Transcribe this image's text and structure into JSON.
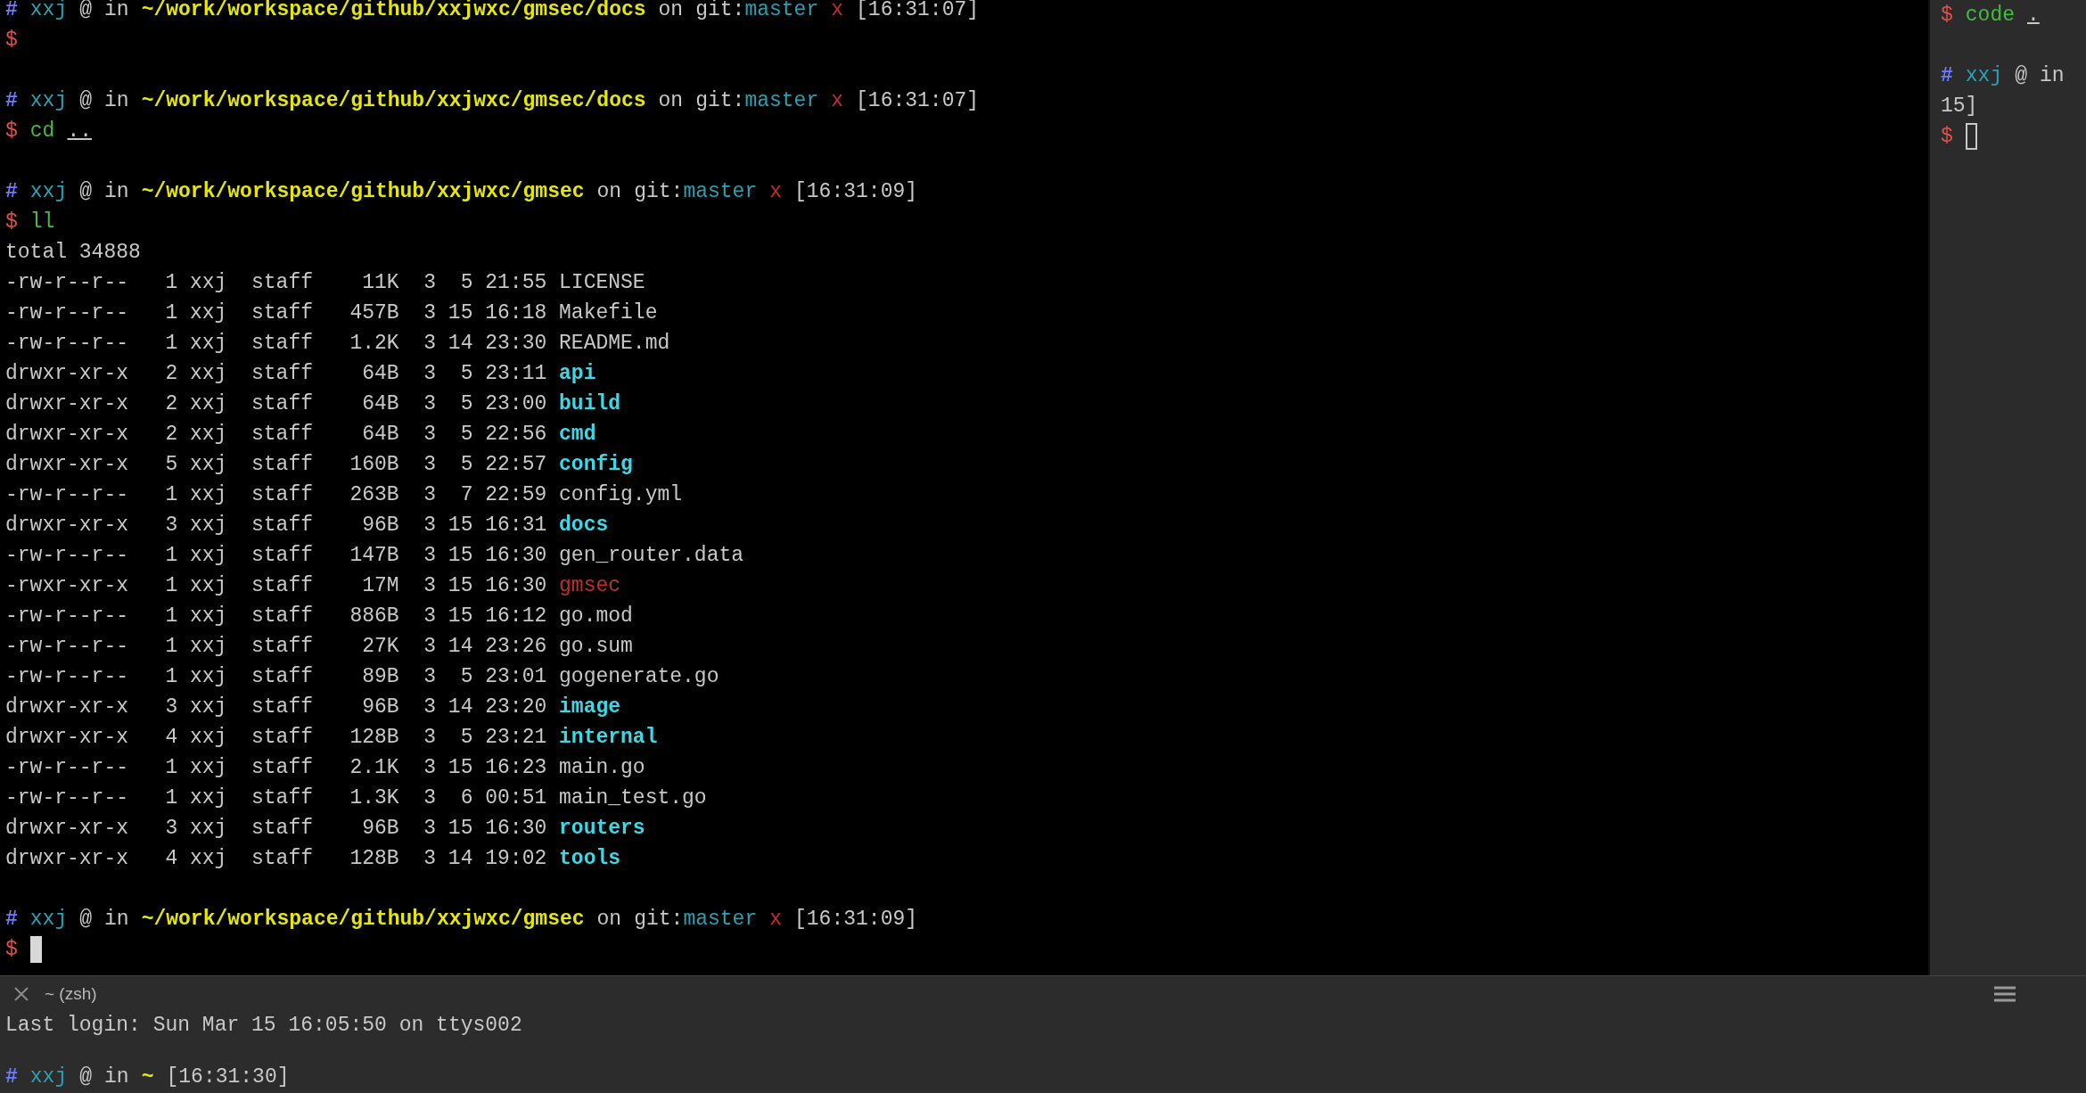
{
  "main_pane": {
    "lines": [
      {
        "kind": "prompt",
        "hash": "#",
        "user": "xxj",
        "at": "@",
        "in": "in",
        "path": "~/work/workspace/github/xxjwxc/gmsec/docs",
        "on": "on",
        "git": "git:",
        "branch": "master",
        "dirty": "x",
        "time": "[16:31:07]"
      },
      {
        "kind": "input",
        "symbol": "$"
      },
      {
        "kind": "blank"
      },
      {
        "kind": "prompt",
        "hash": "#",
        "user": "xxj",
        "at": "@",
        "in": "in",
        "path": "~/work/workspace/github/xxjwxc/gmsec/docs",
        "on": "on",
        "git": "git:",
        "branch": "master",
        "dirty": "x",
        "time": "[16:31:07]"
      },
      {
        "kind": "input",
        "symbol": "$",
        "command": "cd",
        "args": ".."
      },
      {
        "kind": "blank"
      },
      {
        "kind": "prompt",
        "hash": "#",
        "user": "xxj",
        "at": "@",
        "in": "in",
        "path": "~/work/workspace/github/xxjwxc/gmsec",
        "on": "on",
        "git": "git:",
        "branch": "master",
        "dirty": "x",
        "time": "[16:31:09]"
      },
      {
        "kind": "input",
        "symbol": "$",
        "command": "ll"
      },
      {
        "kind": "text",
        "text": "total 34888"
      },
      {
        "kind": "entry",
        "perms": "-rw-r--r--",
        "links": "1",
        "owner": "xxj",
        "group": "staff",
        "size": "11K",
        "month": "3",
        "day": "5",
        "time": "21:55",
        "name": "LICENSE",
        "directory": false,
        "executable": false
      },
      {
        "kind": "entry",
        "perms": "-rw-r--r--",
        "links": "1",
        "owner": "xxj",
        "group": "staff",
        "size": "457B",
        "month": "3",
        "day": "15",
        "time": "16:18",
        "name": "Makefile",
        "directory": false,
        "executable": false
      },
      {
        "kind": "entry",
        "perms": "-rw-r--r--",
        "links": "1",
        "owner": "xxj",
        "group": "staff",
        "size": "1.2K",
        "month": "3",
        "day": "14",
        "time": "23:30",
        "name": "README.md",
        "directory": false,
        "executable": false
      },
      {
        "kind": "entry",
        "perms": "drwxr-xr-x",
        "links": "2",
        "owner": "xxj",
        "group": "staff",
        "size": "64B",
        "month": "3",
        "day": "5",
        "time": "23:11",
        "name": "api",
        "directory": true,
        "executable": false
      },
      {
        "kind": "entry",
        "perms": "drwxr-xr-x",
        "links": "2",
        "owner": "xxj",
        "group": "staff",
        "size": "64B",
        "month": "3",
        "day": "5",
        "time": "23:00",
        "name": "build",
        "directory": true,
        "executable": false
      },
      {
        "kind": "entry",
        "perms": "drwxr-xr-x",
        "links": "2",
        "owner": "xxj",
        "group": "staff",
        "size": "64B",
        "month": "3",
        "day": "5",
        "time": "22:56",
        "name": "cmd",
        "directory": true,
        "executable": false
      },
      {
        "kind": "entry",
        "perms": "drwxr-xr-x",
        "links": "5",
        "owner": "xxj",
        "group": "staff",
        "size": "160B",
        "month": "3",
        "day": "5",
        "time": "22:57",
        "name": "config",
        "directory": true,
        "executable": false
      },
      {
        "kind": "entry",
        "perms": "-rw-r--r--",
        "links": "1",
        "owner": "xxj",
        "group": "staff",
        "size": "263B",
        "month": "3",
        "day": "7",
        "time": "22:59",
        "name": "config.yml",
        "directory": false,
        "executable": false
      },
      {
        "kind": "entry",
        "perms": "drwxr-xr-x",
        "links": "3",
        "owner": "xxj",
        "group": "staff",
        "size": "96B",
        "month": "3",
        "day": "15",
        "time": "16:31",
        "name": "docs",
        "directory": true,
        "executable": false
      },
      {
        "kind": "entry",
        "perms": "-rw-r--r--",
        "links": "1",
        "owner": "xxj",
        "group": "staff",
        "size": "147B",
        "month": "3",
        "day": "15",
        "time": "16:30",
        "name": "gen_router.data",
        "directory": false,
        "executable": false
      },
      {
        "kind": "entry",
        "perms": "-rwxr-xr-x",
        "links": "1",
        "owner": "xxj",
        "group": "staff",
        "size": "17M",
        "month": "3",
        "day": "15",
        "time": "16:30",
        "name": "gmsec",
        "directory": false,
        "executable": true
      },
      {
        "kind": "entry",
        "perms": "-rw-r--r--",
        "links": "1",
        "owner": "xxj",
        "group": "staff",
        "size": "886B",
        "month": "3",
        "day": "15",
        "time": "16:12",
        "name": "go.mod",
        "directory": false,
        "executable": false
      },
      {
        "kind": "entry",
        "perms": "-rw-r--r--",
        "links": "1",
        "owner": "xxj",
        "group": "staff",
        "size": "27K",
        "month": "3",
        "day": "14",
        "time": "23:26",
        "name": "go.sum",
        "directory": false,
        "executable": false
      },
      {
        "kind": "entry",
        "perms": "-rw-r--r--",
        "links": "1",
        "owner": "xxj",
        "group": "staff",
        "size": "89B",
        "month": "3",
        "day": "5",
        "time": "23:01",
        "name": "gogenerate.go",
        "directory": false,
        "executable": false
      },
      {
        "kind": "entry",
        "perms": "drwxr-xr-x",
        "links": "3",
        "owner": "xxj",
        "group": "staff",
        "size": "96B",
        "month": "3",
        "day": "14",
        "time": "23:20",
        "name": "image",
        "directory": true,
        "executable": false
      },
      {
        "kind": "entry",
        "perms": "drwxr-xr-x",
        "links": "4",
        "owner": "xxj",
        "group": "staff",
        "size": "128B",
        "month": "3",
        "day": "5",
        "time": "23:21",
        "name": "internal",
        "directory": true,
        "executable": false
      },
      {
        "kind": "entry",
        "perms": "-rw-r--r--",
        "links": "1",
        "owner": "xxj",
        "group": "staff",
        "size": "2.1K",
        "month": "3",
        "day": "15",
        "time": "16:23",
        "name": "main.go",
        "directory": false,
        "executable": false
      },
      {
        "kind": "entry",
        "perms": "-rw-r--r--",
        "links": "1",
        "owner": "xxj",
        "group": "staff",
        "size": "1.3K",
        "month": "3",
        "day": "6",
        "time": "00:51",
        "name": "main_test.go",
        "directory": false,
        "executable": false
      },
      {
        "kind": "entry",
        "perms": "drwxr-xr-x",
        "links": "3",
        "owner": "xxj",
        "group": "staff",
        "size": "96B",
        "month": "3",
        "day": "15",
        "time": "16:30",
        "name": "routers",
        "directory": true,
        "executable": false
      },
      {
        "kind": "entry",
        "perms": "drwxr-xr-x",
        "links": "4",
        "owner": "xxj",
        "group": "staff",
        "size": "128B",
        "month": "3",
        "day": "14",
        "time": "19:02",
        "name": "tools",
        "directory": true,
        "executable": false
      },
      {
        "kind": "blank"
      },
      {
        "kind": "prompt",
        "hash": "#",
        "user": "xxj",
        "at": "@",
        "in": "in",
        "path": "~/work/workspace/github/xxjwxc/gmsec",
        "on": "on",
        "git": "git:",
        "branch": "master",
        "dirty": "x",
        "time": "[16:31:09]"
      },
      {
        "kind": "input",
        "symbol": "$",
        "cursor": true,
        "filled": true
      }
    ]
  },
  "side_pane": {
    "lines": [
      {
        "kind": "input",
        "symbol": "$",
        "command": "code",
        "args": "."
      },
      {
        "kind": "blank"
      },
      {
        "kind": "prompt",
        "hash": "#",
        "user": "xxj",
        "at": "@",
        "in": "in"
      },
      {
        "kind": "text",
        "text": "15]"
      },
      {
        "kind": "input",
        "symbol": "$",
        "cursor": true,
        "filled": false
      }
    ]
  },
  "bottom_pane": {
    "tab": {
      "title": "~ (zsh)"
    },
    "lines": [
      {
        "kind": "text",
        "text": "Last login: Sun Mar 15 16:05:50 on ttys002"
      },
      {
        "kind": "blank"
      },
      {
        "kind": "prompt",
        "hash": "#",
        "user": "xxj",
        "at": "@",
        "in": "in",
        "path": "~",
        "time": "[16:31:30]"
      }
    ]
  }
}
